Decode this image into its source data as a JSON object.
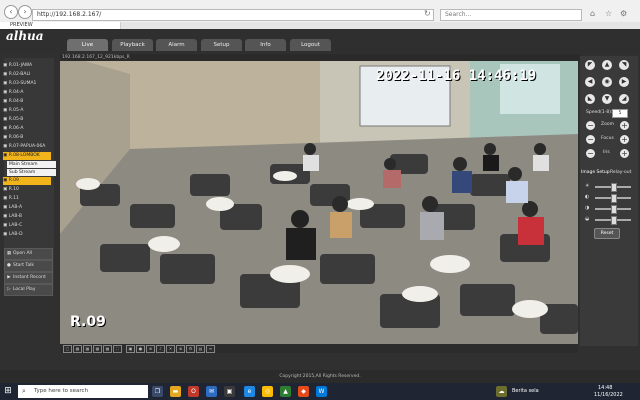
{
  "browser": {
    "url": "http://192.168.2.167/",
    "search_placeholder": "Search...",
    "tab_title": "PREVIEW"
  },
  "app": {
    "logo": "alhua",
    "tabs": [
      {
        "label": "Live",
        "active": true
      },
      {
        "label": "Playback"
      },
      {
        "label": "Alarm"
      },
      {
        "label": "Setup"
      },
      {
        "label": "Info"
      },
      {
        "label": "Logout"
      }
    ]
  },
  "channels": {
    "items": [
      "R.01-JAWA",
      "R.02-BALI",
      "R.03-SUMA1",
      "R.04-A",
      "R.04-B",
      "R.05-A",
      "R.05-B",
      "R.06-A",
      "R.06-B",
      "R.07-PAPUA-06A",
      "R.08-LOMBOK",
      "R.09",
      "R.10",
      "R.11",
      "LAB-A",
      "LAB-B",
      "LAB-C",
      "LAB-D"
    ],
    "selected": "R.08-LOMBOK",
    "sub_main": "Main Stream",
    "sub_sub": "Sub Stream"
  },
  "side_buttons": {
    "open_all": "Open All",
    "start_talk": "Start Talk",
    "instant_record": "Instant Record",
    "local_play": "Local Play"
  },
  "video": {
    "caption": "192.168.2.167_12_921kbps_R",
    "timestamp": "2022-11-16 14:46:19",
    "camera_label": "R.09"
  },
  "ptz": {
    "speed_label": "Speed(1-8):",
    "speed_value": "5",
    "zoom_label": "Zoom",
    "focus_label": "Focus",
    "iris_label": "Iris",
    "image_setup_tab": "Image Setup",
    "relay_out_tab": "Relay-out",
    "reset_label": "Reset",
    "sliders": [
      0.5,
      0.5,
      0.5,
      0.5
    ]
  },
  "footer": {
    "copyright": "Copyright 2015,All Rights Reserved."
  },
  "taskbar": {
    "search_placeholder": "Type here to search",
    "news": "Berita sela",
    "time": "14:48",
    "date": "11/16/2022"
  },
  "colors": {
    "accent": "#f2b41b",
    "taskbar": "#1f2533"
  }
}
